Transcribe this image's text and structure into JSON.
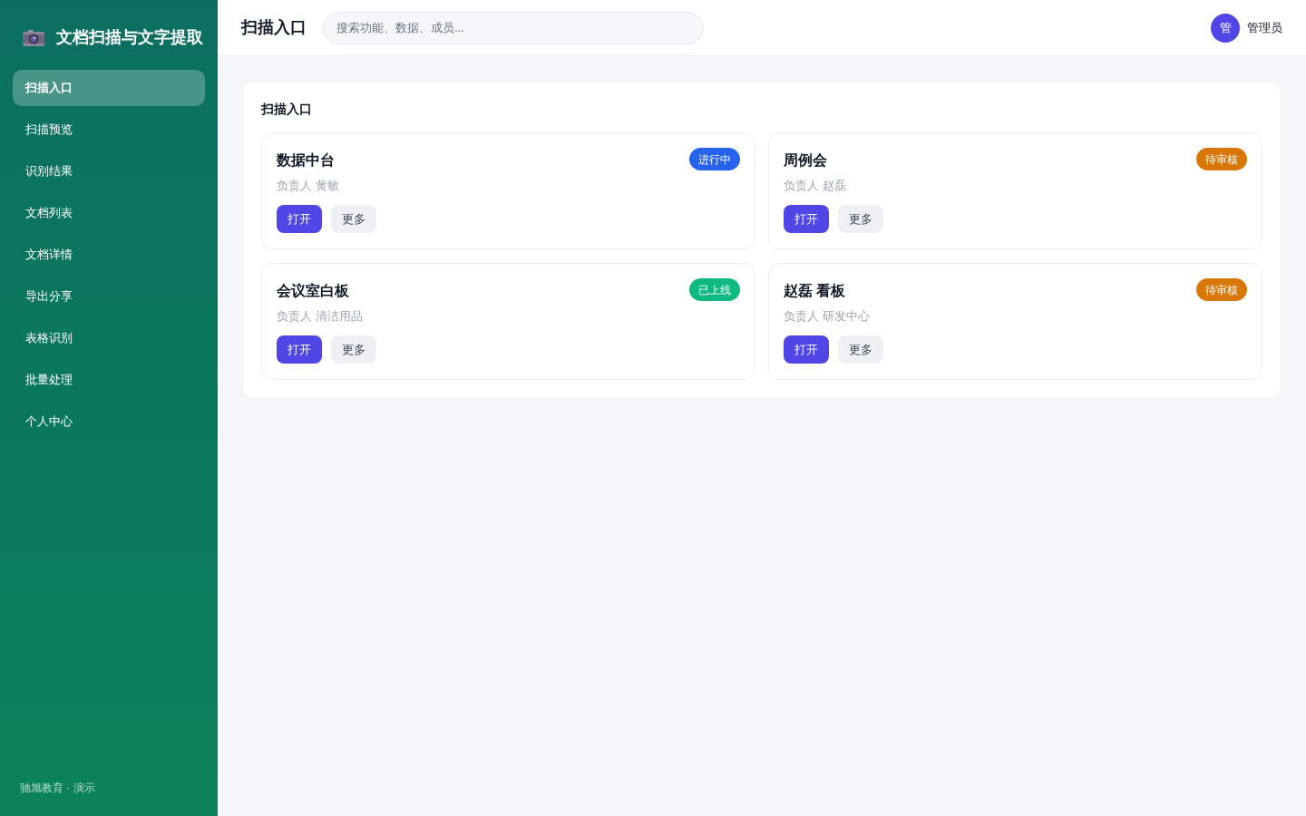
{
  "sidebar": {
    "brand": "文档扫描与文字提取",
    "items": [
      {
        "label": "扫描入口",
        "selected": true
      },
      {
        "label": "扫描预览",
        "selected": false
      },
      {
        "label": "识别结果",
        "selected": false
      },
      {
        "label": "文档列表",
        "selected": false
      },
      {
        "label": "文档详情",
        "selected": false
      },
      {
        "label": "导出分享",
        "selected": false
      },
      {
        "label": "表格识别",
        "selected": false
      },
      {
        "label": "批量处理",
        "selected": false
      },
      {
        "label": "个人中心",
        "selected": false
      }
    ],
    "footer": "驰旭教育 · 演示"
  },
  "header": {
    "title": "扫描入口",
    "search": {
      "placeholder": "搜索功能、数据、成员..."
    },
    "user": {
      "avatar": "管",
      "name": "管理员"
    }
  },
  "panel": {
    "title": "扫描入口",
    "cards": [
      {
        "title": "数据中台",
        "status": "进行中",
        "color": "#2563eb",
        "owner": "负责人 黄敏",
        "actions": [
          {
            "label": "打开",
            "kind": "primary"
          },
          {
            "label": "更多",
            "kind": "secondary"
          }
        ]
      },
      {
        "title": "周例会",
        "status": "待审核",
        "color": "#d97706",
        "owner": "负责人 赵磊",
        "actions": [
          {
            "label": "打开",
            "kind": "primary"
          },
          {
            "label": "更多",
            "kind": "secondary"
          }
        ]
      },
      {
        "title": "会议室白板",
        "status": "已上线",
        "color": "#10b981",
        "owner": "负责人 清洁用品",
        "actions": [
          {
            "label": "打开",
            "kind": "primary"
          },
          {
            "label": "更多",
            "kind": "secondary"
          }
        ]
      },
      {
        "title": "赵磊 看板",
        "status": "待审核",
        "color": "#d97706",
        "owner": "负责人 研发中心",
        "actions": [
          {
            "label": "打开",
            "kind": "primary"
          },
          {
            "label": "更多",
            "kind": "secondary"
          }
        ]
      }
    ]
  }
}
